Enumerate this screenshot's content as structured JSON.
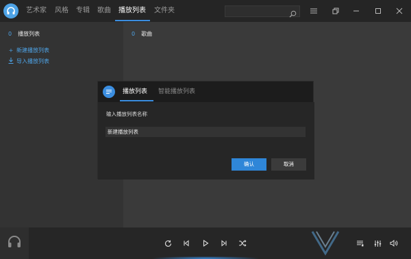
{
  "app": {
    "tabs": [
      "艺术家",
      "风格",
      "专辑",
      "歌曲",
      "播放列表",
      "文件夹"
    ],
    "active_tab": "播放列表",
    "search_placeholder": ""
  },
  "sidebar": {
    "playlist_count": "0",
    "playlist_label": "播放列表",
    "new_playlist": "新建播放列表",
    "import_playlist": "导入播放列表"
  },
  "main": {
    "song_count": "0",
    "song_label": "歌曲"
  },
  "dialog": {
    "tabs": [
      "播放列表",
      "智能播放列表"
    ],
    "prompt": "输入播放列表名称",
    "input_value": "新建播放列表",
    "ok_label": "确认",
    "cancel_label": "取消"
  },
  "colors": {
    "accent": "#3b8ee0",
    "background": "#3a3a3a",
    "topbar": "#252525",
    "dialog": "#1c1c1c"
  },
  "icons": {
    "logo": "headphones-icon",
    "search": "search-icon",
    "menu": "hamburger-icon",
    "restore": "restore-icon",
    "minimize": "minimize-icon",
    "maximize": "maximize-icon",
    "close": "close-icon",
    "repeat": "repeat-icon",
    "previous": "previous-icon",
    "play": "play-icon",
    "next": "next-icon",
    "shuffle": "shuffle-icon",
    "queue": "queue-icon",
    "equalizer": "equalizer-icon",
    "volume": "volume-icon"
  }
}
